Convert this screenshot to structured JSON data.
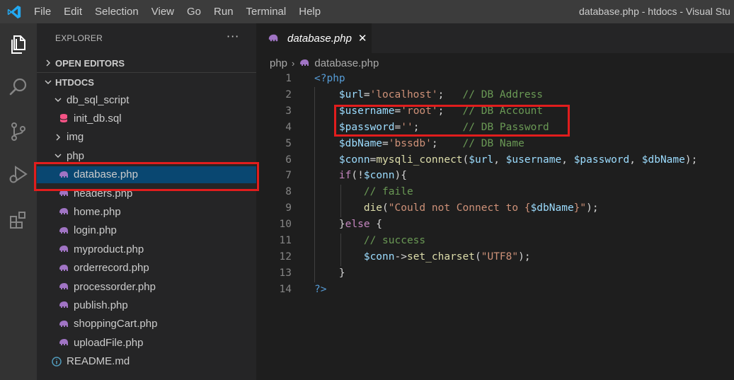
{
  "menu": [
    "File",
    "Edit",
    "Selection",
    "View",
    "Go",
    "Run",
    "Terminal",
    "Help"
  ],
  "window_title": "database.php - htdocs - Visual Stu",
  "sidebar": {
    "header": "EXPLORER",
    "more": "···",
    "sections": {
      "open_editors": "OPEN EDITORS",
      "root": "HTDOCS"
    },
    "tree": [
      {
        "label": "db_sql_script",
        "kind": "folder-open"
      },
      {
        "label": "init_db.sql",
        "kind": "sql-file"
      },
      {
        "label": "img",
        "kind": "folder-closed"
      },
      {
        "label": "php",
        "kind": "folder-open"
      },
      {
        "label": "database.php",
        "kind": "php-file",
        "selected": true
      },
      {
        "label": "headers.php",
        "kind": "php-file"
      },
      {
        "label": "home.php",
        "kind": "php-file"
      },
      {
        "label": "login.php",
        "kind": "php-file"
      },
      {
        "label": "myproduct.php",
        "kind": "php-file"
      },
      {
        "label": "orderrecord.php",
        "kind": "php-file"
      },
      {
        "label": "processorder.php",
        "kind": "php-file"
      },
      {
        "label": "publish.php",
        "kind": "php-file"
      },
      {
        "label": "shoppingCart.php",
        "kind": "php-file"
      },
      {
        "label": "uploadFile.php",
        "kind": "php-file"
      },
      {
        "label": "README.md",
        "kind": "info-file"
      }
    ]
  },
  "tab": {
    "label": "database.php",
    "close": "✕"
  },
  "breadcrumb": {
    "folder": "php",
    "sep": "›",
    "file": "database.php"
  },
  "code": {
    "line_numbers": [
      "1",
      "2",
      "3",
      "4",
      "5",
      "6",
      "7",
      "8",
      "9",
      "10",
      "11",
      "12",
      "13",
      "14"
    ],
    "lines": [
      [
        [
          "tag",
          "<?php"
        ]
      ],
      [
        [
          "var",
          "    $url"
        ],
        [
          "punc",
          "="
        ],
        [
          "str",
          "'localhost'"
        ],
        [
          "punc",
          ";   "
        ],
        [
          "com",
          "// DB Address"
        ]
      ],
      [
        [
          "var",
          "    $username"
        ],
        [
          "punc",
          "="
        ],
        [
          "str",
          "'root'"
        ],
        [
          "punc",
          ";   "
        ],
        [
          "com",
          "// DB Account"
        ]
      ],
      [
        [
          "var",
          "    $password"
        ],
        [
          "punc",
          "="
        ],
        [
          "str",
          "''"
        ],
        [
          "punc",
          ";       "
        ],
        [
          "com",
          "// DB Password"
        ]
      ],
      [
        [
          "var",
          "    $dbName"
        ],
        [
          "punc",
          "="
        ],
        [
          "str",
          "'bssdb'"
        ],
        [
          "punc",
          ";    "
        ],
        [
          "com",
          "// DB Name"
        ]
      ],
      [
        [
          "var",
          "    $conn"
        ],
        [
          "punc",
          "="
        ],
        [
          "fn",
          "mysqli_connect"
        ],
        [
          "punc",
          "("
        ],
        [
          "var",
          "$url"
        ],
        [
          "punc",
          ", "
        ],
        [
          "var",
          "$username"
        ],
        [
          "punc",
          ", "
        ],
        [
          "var",
          "$password"
        ],
        [
          "punc",
          ", "
        ],
        [
          "var",
          "$dbName"
        ],
        [
          "punc",
          ");"
        ]
      ],
      [
        [
          "kw",
          "    if"
        ],
        [
          "punc",
          "(!"
        ],
        [
          "var",
          "$conn"
        ],
        [
          "punc",
          "){"
        ]
      ],
      [
        [
          "com",
          "        // faile"
        ]
      ],
      [
        [
          "fn",
          "        die"
        ],
        [
          "punc",
          "("
        ],
        [
          "str",
          "\"Could not Connect to {"
        ],
        [
          "var",
          "$dbName"
        ],
        [
          "str",
          "}\""
        ],
        [
          "punc",
          ");"
        ]
      ],
      [
        [
          "punc",
          "    }"
        ],
        [
          "kw",
          "else"
        ],
        [
          "punc",
          " {"
        ]
      ],
      [
        [
          "com",
          "        // success"
        ]
      ],
      [
        [
          "var",
          "        $conn"
        ],
        [
          "punc",
          "->"
        ],
        [
          "fn",
          "set_charset"
        ],
        [
          "punc",
          "("
        ],
        [
          "str",
          "\"UTF8\""
        ],
        [
          "punc",
          ");"
        ]
      ],
      [
        [
          "punc",
          "    }"
        ]
      ],
      [
        [
          "tag",
          "?>"
        ]
      ]
    ]
  },
  "colors": {
    "activity_bar": "#333333",
    "sidebar": "#252526",
    "editor": "#1e1e1e",
    "selection": "#094771",
    "highlight_border": "#e11d1d",
    "vscode_blue": "#23a9f2",
    "php_icon": "#a074c4",
    "sql_icon": "#f55385"
  },
  "icons": {
    "activity": [
      "explorer-icon",
      "search-icon",
      "source-control-icon",
      "run-debug-icon",
      "extensions-icon"
    ]
  }
}
